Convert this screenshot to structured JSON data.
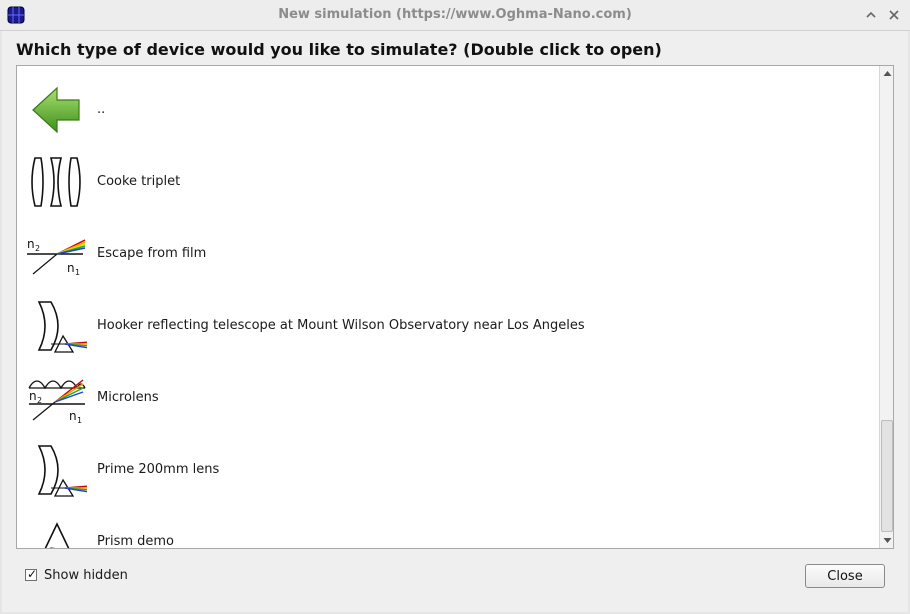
{
  "window": {
    "title": "New simulation (https://www.Oghma-Nano.com)",
    "app_icon": "oghma-app-icon",
    "minimize_icon": "chevron-up-icon",
    "close_icon": "close-icon"
  },
  "dialog": {
    "heading": "Which type of device would you like to simulate? (Double click to open)"
  },
  "items": [
    {
      "label": "..",
      "icon": "back-arrow-icon"
    },
    {
      "label": "Cooke triplet",
      "icon": "lens-triplet-icon"
    },
    {
      "label": "Escape from film",
      "icon": "refraction-film-icon"
    },
    {
      "label": "Hooker reflecting telescope at Mount Wilson Observatory near Los Angeles",
      "icon": "mirror-prism-icon"
    },
    {
      "label": "Microlens",
      "icon": "microlens-icon"
    },
    {
      "label": "Prime 200mm lens",
      "icon": "mirror-prism-icon"
    },
    {
      "label": "Prism demo",
      "icon": "prism-icon"
    }
  ],
  "footer": {
    "show_hidden_label": "Show hidden",
    "show_hidden_checked": true,
    "check_glyph": "✓",
    "close_label": "Close"
  },
  "colors": {
    "arrow_green": "#5fb030",
    "title_text": "#8c8c8c"
  }
}
